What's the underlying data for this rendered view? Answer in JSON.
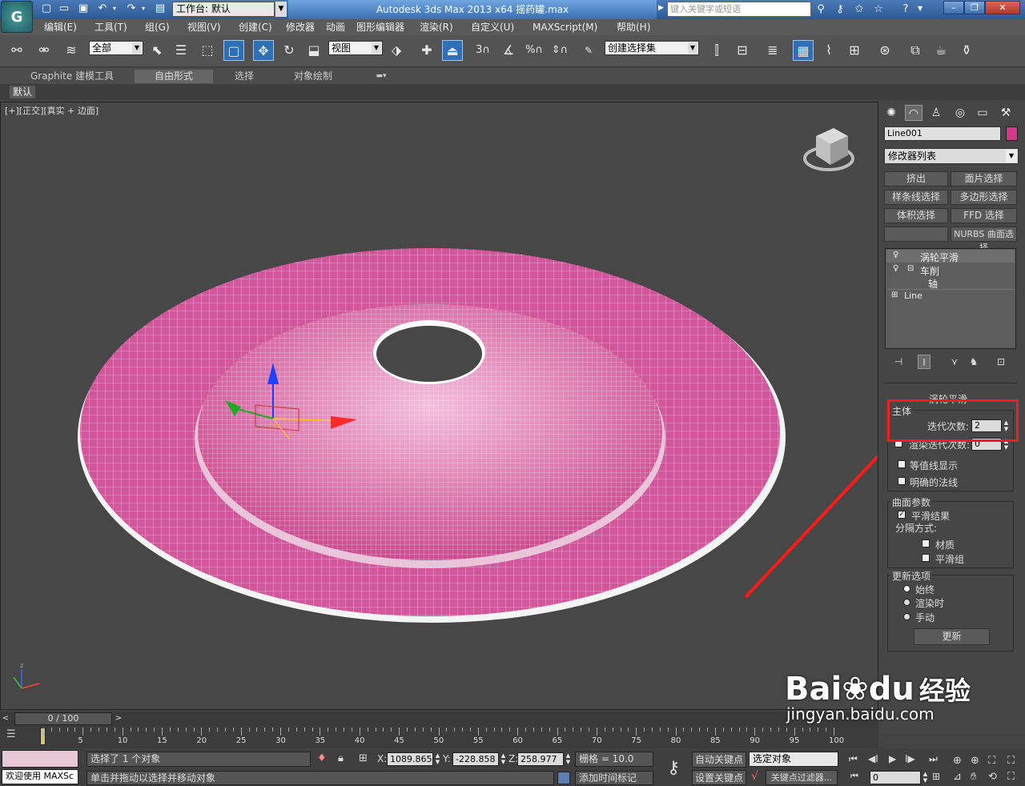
{
  "titlebar": {
    "logo": "G",
    "workspace": "工作台: 默认",
    "app_title": "Autodesk 3ds Max  2013 x64      摇药罐.max",
    "search_placeholder": "键入关键字或短语",
    "quick_icons": [
      "new-file-icon",
      "open-file-icon",
      "save-icon",
      "undo-icon",
      "undo-dropdown-icon",
      "redo-icon",
      "redo-dropdown-icon",
      "project-folder-icon"
    ],
    "right_icons": [
      "binoculars-icon",
      "key-icon",
      "star-icon",
      "help-icon"
    ]
  },
  "menu": [
    "编辑(E)",
    "工具(T)",
    "组(G)",
    "视图(V)",
    "创建(C)",
    "修改器",
    "动画",
    "图形编辑器",
    "渲染(R)",
    "自定义(U)",
    "MAXScript(M)",
    "帮助(H)"
  ],
  "toolbar": {
    "filter_value": "全部",
    "refcoord_value": "视图",
    "selection_set_value": "创建选择集"
  },
  "ribbon": {
    "tabs": [
      "Graphite 建模工具",
      "自由形式",
      "选择",
      "对象绘制"
    ],
    "active_tab": "自由形式",
    "default_label": "默认"
  },
  "viewport": {
    "label": "[+][正交][真实 + 边面]",
    "mesh_color": "#d0579a",
    "wire_color": "#ffffff"
  },
  "panel": {
    "object_name": "Line001",
    "object_color": "#d13a8a",
    "modifier_list": "修改器列表",
    "modifier_buttons": [
      "挤出",
      "面片选择",
      "样条线选择",
      "多边形选择",
      "体积选择",
      "FFD 选择",
      "",
      "NURBS 曲面选择"
    ],
    "stack": {
      "top": "涡轮平滑",
      "lathe": "车削",
      "axis": "轴",
      "base": "Line"
    },
    "rollout": {
      "title": "涡轮平滑",
      "main_group": "主体",
      "iterations_label": "迭代次数:",
      "iterations_value": "2",
      "render_iters_label": "渲染迭代次数:",
      "render_iters_value": "0",
      "isoline_label": "等值线显示",
      "explicit_normals_label": "明确的法线",
      "surface_group": "曲面参数",
      "smooth_result_label": "平滑结果",
      "separate_by_label": "分隔方式:",
      "materials_label": "材质",
      "smoothing_groups_label": "平滑组",
      "update_group": "更新选项",
      "always_label": "始终",
      "when_rendering_label": "渲染时",
      "manually_label": "手动",
      "update_button": "更新"
    },
    "highlight_color": "#ff1a1a"
  },
  "timeline": {
    "slider_label": "0 / 100",
    "ticks": [
      "0",
      "5",
      "10",
      "15",
      "20",
      "25",
      "30",
      "35",
      "40",
      "45",
      "50",
      "55",
      "60",
      "65",
      "70",
      "75",
      "80",
      "85",
      "90",
      "95",
      "100"
    ]
  },
  "status": {
    "welcome": "欢迎使用 MAXSc",
    "selected": "选择了 1 个对象",
    "prompt": "单击并拖动以选择并移动对象",
    "x_label": "X:",
    "x_value": "1089.865",
    "y_label": "Y:",
    "y_value": "-228.858",
    "z_label": "Z:",
    "z_value": "258.977",
    "grid": "栅格 = 10.0",
    "add_time_tag": "添加时间标记",
    "auto_key": "自动关键点",
    "selected_obj": "选定对象",
    "set_key": "设置关键点",
    "key_filters": "关键点过滤器...",
    "frame": "0"
  },
  "watermark": {
    "brand": "Bai",
    "brand2": "du",
    "cn": "经验",
    "url": "jingyan.baidu.com"
  }
}
